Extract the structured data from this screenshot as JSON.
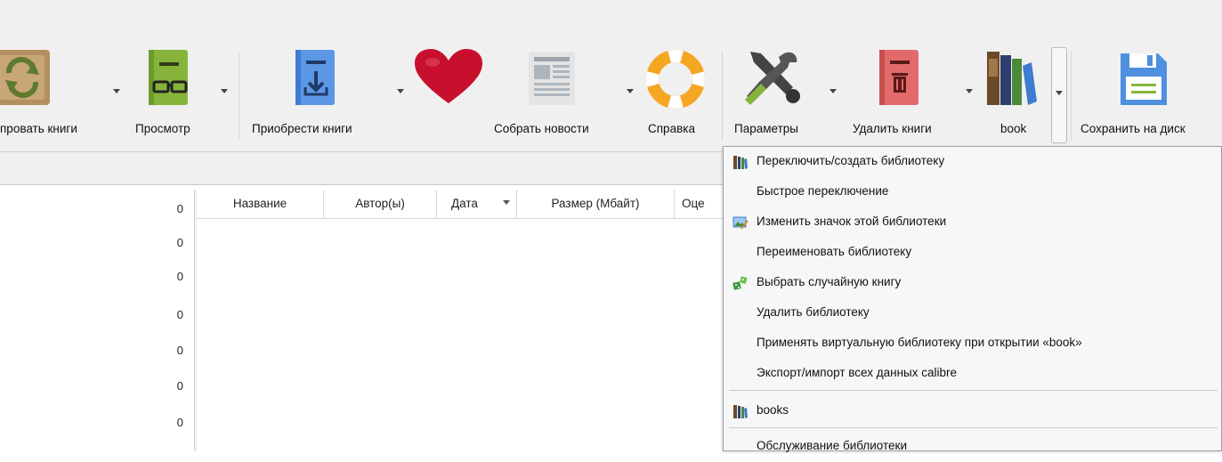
{
  "toolbar": {
    "items": [
      {
        "label": "провать книги",
        "icon": "convert-books-icon"
      },
      {
        "label": "Просмотр",
        "icon": "view-book-icon"
      },
      {
        "label": "Приобрести книги",
        "icon": "get-books-icon"
      },
      {
        "label": "",
        "icon": "donate-heart-icon"
      },
      {
        "label": "Собрать новости",
        "icon": "fetch-news-icon"
      },
      {
        "label": "Справка",
        "icon": "help-lifebuoy-icon"
      },
      {
        "label": "Параметры",
        "icon": "preferences-tools-icon"
      },
      {
        "label": "Удалить книги",
        "icon": "remove-books-icon"
      },
      {
        "label": "book",
        "icon": "library-books-icon"
      },
      {
        "label": "Сохранить на диск",
        "icon": "save-to-disk-icon"
      }
    ]
  },
  "left_counts": [
    "0",
    "0",
    "0",
    "0",
    "0",
    "0",
    "0"
  ],
  "table": {
    "columns": [
      "Название",
      "Автор(ы)",
      "Дата",
      "Размер (Мбайт)",
      "Оце"
    ],
    "sorted_column": "Дата"
  },
  "library_menu": {
    "items": [
      {
        "label": "Переключить/создать библиотеку",
        "icon": "library-books-icon"
      },
      {
        "label": "Быстрое переключение",
        "icon": ""
      },
      {
        "label": "Изменить значок этой библиотеки",
        "icon": "image-edit-icon"
      },
      {
        "label": "Переименовать библиотеку",
        "icon": ""
      },
      {
        "label": "Выбрать случайную книгу",
        "icon": "random-dice-icon"
      },
      {
        "label": "Удалить библиотеку",
        "icon": ""
      },
      {
        "label": "Применять виртуальную библиотеку при открытии «book»",
        "icon": ""
      },
      {
        "label": "Экспорт/импорт всех данных calibre",
        "icon": ""
      },
      {
        "label": "books",
        "icon": "library-books-icon"
      },
      {
        "label": "Обслуживание библиотеки",
        "icon": ""
      }
    ]
  },
  "colors": {
    "toolbar_bg": "#f0f0f0",
    "menu_bg": "#f7f7f7",
    "heart": "#c8102e",
    "green": "#7fb33a",
    "blue": "#4f8fe0",
    "red": "#e06666"
  }
}
